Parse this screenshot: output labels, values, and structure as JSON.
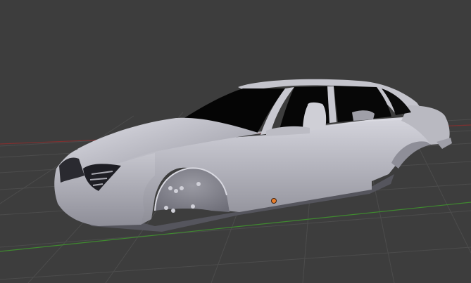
{
  "viewport": {
    "background": "#3d3d3d",
    "grid_color": "#4d4d4d",
    "x_axis_color": "#8b2f2f",
    "y_axis_color": "#3f8a2f",
    "origin_color": "#e87d2a"
  },
  "model": {
    "body_color": "#b7b7c0",
    "shadow_color": "#4a4a52",
    "window_color": "#050505",
    "icons": [
      "object-origin-icon"
    ]
  }
}
